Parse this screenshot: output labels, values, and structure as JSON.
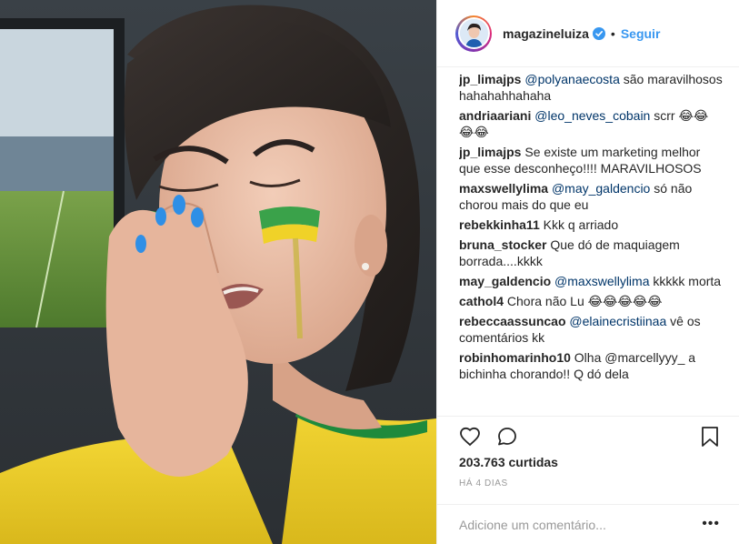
{
  "post": {
    "username": "magazineluiza",
    "verified_icon": "verified-badge-icon",
    "separator": "•",
    "follow_label": "Seguir"
  },
  "comments": [
    {
      "user": "jp_limajps",
      "mention": "@polyanaecosta",
      "text": " são maravilhosos hahahahhahaha"
    },
    {
      "user": "andriaariani",
      "mention": "@leo_neves_cobain",
      "text": " scrr 😂😂😂😂"
    },
    {
      "user": "jp_limajps",
      "mention": "",
      "text": "Se existe um marketing melhor que esse desconheço!!!! MARAVILHOSOS"
    },
    {
      "user": "maxswellylima",
      "mention": "@may_galdencio",
      "text": " só não chorou mais do que eu"
    },
    {
      "user": "rebekkinha11",
      "mention": "",
      "text": "Kkk q arriado"
    },
    {
      "user": "bruna_stocker",
      "mention": "",
      "text": "Que dó de maquiagem borrada....kkkk"
    },
    {
      "user": "may_galdencio",
      "mention": "@maxswellylima",
      "text": " kkkkk morta"
    },
    {
      "user": "cathol4",
      "mention": "",
      "text": "Chora não Lu 😂😂😂😂😂"
    },
    {
      "user": "rebeccaassuncao",
      "mention": "@elainecristiinaa",
      "text": " vê os comentários kk"
    },
    {
      "user": "robinhomarinho10",
      "mention": "",
      "text": "Olha @marcellyyy_ a bichinha chorando!! Q dó dela"
    }
  ],
  "stats": {
    "likes": "203.763 curtidas",
    "date": "HÁ 4 DIAS"
  },
  "composer": {
    "placeholder": "Adicione um comentário...",
    "more": "•••"
  },
  "icons": {
    "like": "heart-icon",
    "comment": "comment-icon",
    "save": "bookmark-icon"
  },
  "colors": {
    "link": "#3897f0",
    "mention": "#003569",
    "muted": "#999999"
  }
}
